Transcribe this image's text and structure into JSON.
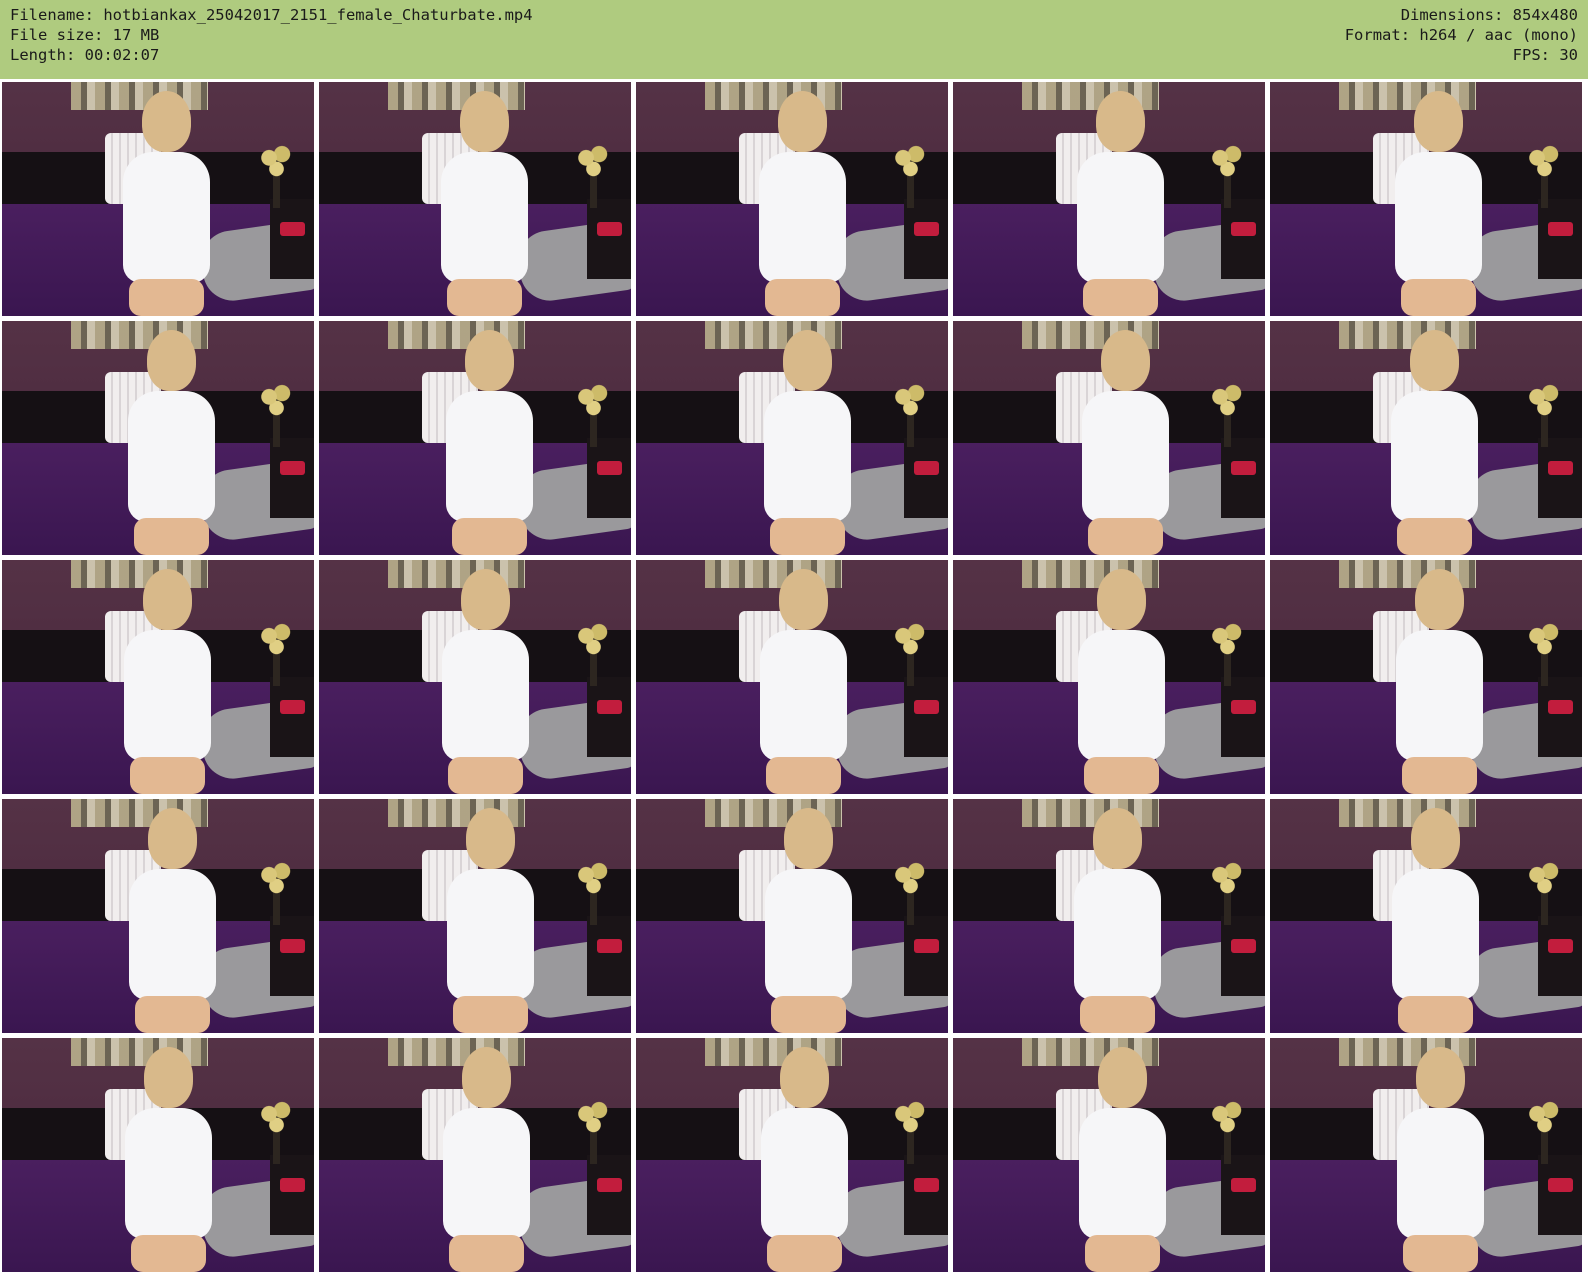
{
  "header": {
    "left": [
      "Filename: hotbiankax_25042017_2151_female_Chaturbate.mp4",
      "File size: 17 MB",
      "Length: 00:02:07"
    ],
    "right": [
      "Dimensions: 854x480",
      "Format: h264 / aac (mono)",
      "FPS: 30"
    ]
  },
  "grid": {
    "rows": 5,
    "columns": 5,
    "thumbnail_count": 25
  },
  "colors": {
    "header_bg": "#afcb7f",
    "page_bg": "#ffffff"
  }
}
